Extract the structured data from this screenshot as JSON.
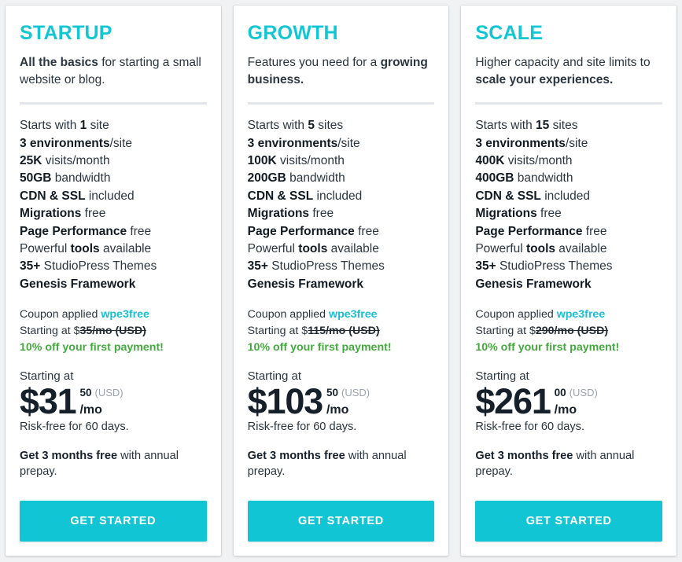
{
  "theme": {
    "accent": "#14c6d4",
    "cta_background": "#12c5d4",
    "discount_green": "#45a93f",
    "page_background": "#f1f2f3",
    "divider": "#e2e6ec"
  },
  "plans": [
    {
      "name": "STARTUP",
      "tagline_bold": "All the basics",
      "tagline_rest": " for starting a small website or blog.",
      "features": [
        {
          "pre": "Starts with ",
          "bold": "1",
          "post": " site"
        },
        {
          "pre": "",
          "bold": "3 environments",
          "post": "/site"
        },
        {
          "pre": "",
          "bold": "25K",
          "post": " visits/month"
        },
        {
          "pre": "",
          "bold": "50GB",
          "post": " bandwidth"
        },
        {
          "pre": "",
          "bold": "CDN & SSL",
          "post": " included"
        },
        {
          "pre": "",
          "bold": "Migrations",
          "post": " free"
        },
        {
          "pre": "",
          "bold": "Page Performance",
          "post": " free"
        },
        {
          "pre": "Powerful ",
          "bold": "tools",
          "post": " available"
        },
        {
          "pre": "",
          "bold": "35+",
          "post": " StudioPress Themes"
        },
        {
          "pre": "",
          "bold": "Genesis Framework",
          "post": ""
        }
      ],
      "coupon_label": "Coupon applied",
      "coupon_code": "wpe3free",
      "old_price_label": "Starting at $",
      "old_price": "35/mo (USD)",
      "discount_text": "10% off your first payment!",
      "starting_at_label": "Starting at",
      "price_main": "$31",
      "price_cents": "50",
      "price_currency": "(USD)",
      "price_period": "/mo",
      "risk_free": "Risk-free for 60 days.",
      "annual_bold": "Get 3 months free",
      "annual_rest": " with annual prepay.",
      "cta_label": "GET STARTED"
    },
    {
      "name": "GROWTH",
      "tagline_bold": "growing business.",
      "tagline_rest": "Features you need for a ",
      "features": [
        {
          "pre": "Starts with ",
          "bold": "5",
          "post": " sites"
        },
        {
          "pre": "",
          "bold": "3 environments",
          "post": "/site"
        },
        {
          "pre": "",
          "bold": "100K",
          "post": " visits/month"
        },
        {
          "pre": "",
          "bold": "200GB",
          "post": " bandwidth"
        },
        {
          "pre": "",
          "bold": "CDN & SSL",
          "post": " included"
        },
        {
          "pre": "",
          "bold": "Migrations",
          "post": " free"
        },
        {
          "pre": "",
          "bold": "Page Performance",
          "post": " free"
        },
        {
          "pre": "Powerful ",
          "bold": "tools",
          "post": " available"
        },
        {
          "pre": "",
          "bold": "35+",
          "post": " StudioPress Themes"
        },
        {
          "pre": "",
          "bold": "Genesis Framework",
          "post": ""
        }
      ],
      "coupon_label": "Coupon applied",
      "coupon_code": "wpe3free",
      "old_price_label": "Starting at $",
      "old_price": "115/mo (USD)",
      "discount_text": "10% off your first payment!",
      "starting_at_label": "Starting at",
      "price_main": "$103",
      "price_cents": "50",
      "price_currency": "(USD)",
      "price_period": "/mo",
      "risk_free": "Risk-free for 60 days.",
      "annual_bold": "Get 3 months free",
      "annual_rest": " with annual prepay.",
      "cta_label": "GET STARTED"
    },
    {
      "name": "SCALE",
      "tagline_bold": "scale your experiences.",
      "tagline_rest": "Higher capacity and site limits to ",
      "features": [
        {
          "pre": "Starts with ",
          "bold": "15",
          "post": " sites"
        },
        {
          "pre": "",
          "bold": "3 environments",
          "post": "/site"
        },
        {
          "pre": "",
          "bold": "400K",
          "post": " visits/month"
        },
        {
          "pre": "",
          "bold": "400GB",
          "post": " bandwidth"
        },
        {
          "pre": "",
          "bold": "CDN & SSL",
          "post": " included"
        },
        {
          "pre": "",
          "bold": "Migrations",
          "post": " free"
        },
        {
          "pre": "",
          "bold": "Page Performance",
          "post": " free"
        },
        {
          "pre": "Powerful ",
          "bold": "tools",
          "post": " available"
        },
        {
          "pre": "",
          "bold": "35+",
          "post": " StudioPress Themes"
        },
        {
          "pre": "",
          "bold": "Genesis Framework",
          "post": ""
        }
      ],
      "coupon_label": "Coupon applied",
      "coupon_code": "wpe3free",
      "old_price_label": "Starting at $",
      "old_price": "290/mo (USD)",
      "discount_text": "10% off your first payment!",
      "starting_at_label": "Starting at",
      "price_main": "$261",
      "price_cents": "00",
      "price_currency": "(USD)",
      "price_period": "/mo",
      "risk_free": "Risk-free for 60 days.",
      "annual_bold": "Get 3 months free",
      "annual_rest": " with annual prepay.",
      "cta_label": "GET STARTED"
    }
  ]
}
